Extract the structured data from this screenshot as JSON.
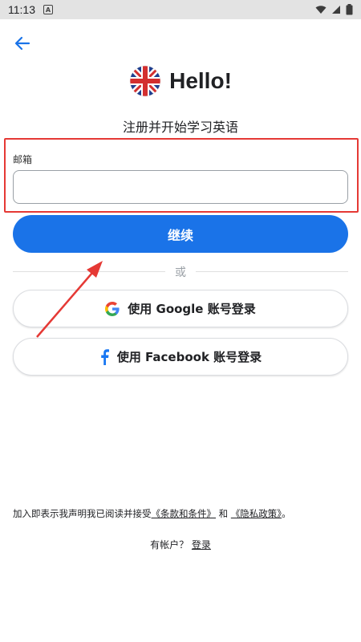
{
  "status_bar": {
    "time": "11:13",
    "notification_glyph": "A",
    "icons": [
      "wifi-icon",
      "signal-icon",
      "battery-icon"
    ]
  },
  "header": {
    "back_icon": "arrow-left-icon",
    "logo_icon": "uk-flag-icon",
    "title": "Hello!",
    "subtitle": "注册并开始学习英语"
  },
  "form": {
    "email_label": "邮箱",
    "email_value": "",
    "continue_label": "继续",
    "divider_text": "或"
  },
  "social": {
    "google_label": "使用 Google 账号登录",
    "facebook_label": "使用 Facebook 账号登录"
  },
  "footer": {
    "terms_prefix": "加入即表示我声明我已阅读并接受",
    "terms_link": "《条款和条件》",
    "terms_and": "和",
    "privacy_link": "《隐私政策》",
    "terms_suffix": "。",
    "have_account": "有帐户？",
    "login_label": "登录"
  },
  "colors": {
    "primary": "#1a73e8",
    "highlight": "#e53935",
    "status_bar": "#e3e3e3"
  }
}
